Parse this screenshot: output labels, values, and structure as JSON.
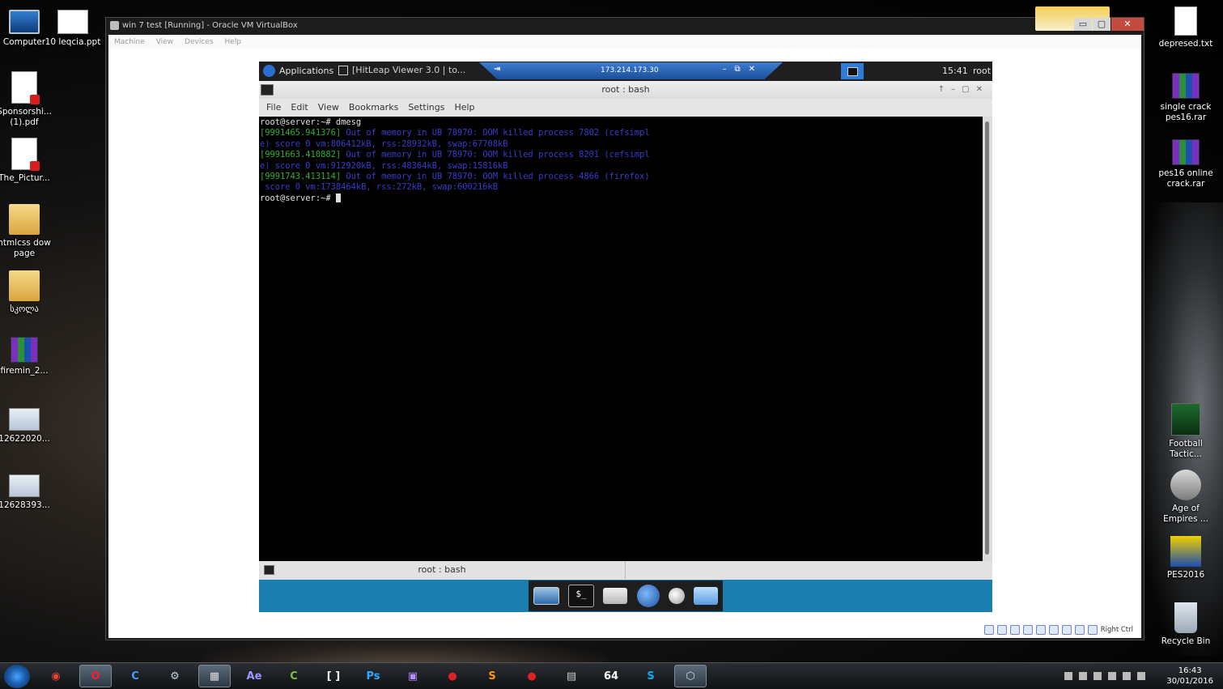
{
  "desktop": {
    "left_icons": [
      {
        "label": "Computer",
        "icon": "computer-icon"
      },
      {
        "label": "10 leqcia.ppt",
        "icon": "powerpoint-file-icon"
      },
      {
        "label": "Sponsorshi... (1).pdf",
        "icon": "pdf-file-icon"
      },
      {
        "label": "The_Pictur...",
        "icon": "pdf-file-icon"
      },
      {
        "label": "htmlcss dow page",
        "icon": "folder-icon"
      },
      {
        "label": "სკოლა",
        "icon": "folder-icon"
      },
      {
        "label": "firemin_2...",
        "icon": "rar-archive-icon"
      },
      {
        "label": "12622020...",
        "icon": "image-file-icon"
      },
      {
        "label": "12628393...",
        "icon": "image-file-icon"
      }
    ],
    "right_icons": [
      {
        "label": "depresed.txt",
        "icon": "text-file-icon"
      },
      {
        "label": "single crack pes16.rar",
        "icon": "rar-archive-icon"
      },
      {
        "label": "pes16 online crack.rar",
        "icon": "rar-archive-icon"
      },
      {
        "label": "Football Tactic...",
        "icon": "game-shortcut-icon"
      },
      {
        "label": "Age of Empires ...",
        "icon": "game-shortcut-icon"
      },
      {
        "label": "PES2016",
        "icon": "game-shortcut-icon"
      },
      {
        "label": "Recycle Bin",
        "icon": "recycle-bin-icon"
      }
    ]
  },
  "vbox": {
    "title": "win 7 test [Running] - Oracle VM VirtualBox",
    "controls": {
      "minimize": "▭",
      "restore": "▢",
      "close": "✕"
    },
    "menu": [
      "Machine",
      "View",
      "Devices",
      "Help"
    ],
    "status": {
      "host_key": "Right Ctrl"
    }
  },
  "guest": {
    "top_panel": {
      "applications": "Applications",
      "task": "[HitLeap Viewer 3.0 | to...",
      "remote_ip": "173.214.173.30",
      "remote_pin": "⇥",
      "remote_controls": "–⧉✕",
      "clock": "15:41",
      "user": "root"
    },
    "terminal": {
      "title": "root : bash",
      "window_controls": "↑–▢✕",
      "menu": [
        "File",
        "Edit",
        "View",
        "Bookmarks",
        "Settings",
        "Help"
      ],
      "lines": [
        {
          "ts": "",
          "msg": "root@server:~# dmesg",
          "kind": "prompt"
        },
        {
          "ts": "[9991465.941376]",
          "msg": " Out of memory in UB 78970: OOM killed process 7802 (cefsimpl",
          "kind": "log"
        },
        {
          "ts": "",
          "msg": "e) score 0 vm:806412kB, rss:28932kB, swap:67708kB",
          "kind": "cont"
        },
        {
          "ts": "[9991663.410882]",
          "msg": " Out of memory in UB 78970: OOM killed process 8201 (cefsimpl",
          "kind": "log"
        },
        {
          "ts": "",
          "msg": "e) score 0 vm:912920kB, rss:48364kB, swap:15816kB",
          "kind": "cont"
        },
        {
          "ts": "[9991743.413114]",
          "msg": " Out of memory in UB 78970: OOM killed process 4866 (firefox)",
          "kind": "log"
        },
        {
          "ts": "",
          "msg": " score 0 vm:1738464kB, rss:272kB, swap:600216kB",
          "kind": "cont"
        }
      ],
      "final_prompt": "root@server:~# ",
      "tab_label": "root : bash"
    },
    "dock": [
      "show-desktop-icon",
      "terminal-icon",
      "home-folder-icon",
      "web-browser-icon",
      "app-finder-icon",
      "file-manager-icon"
    ],
    "dock_term_glyph": "$_"
  },
  "taskbar": {
    "apps": [
      {
        "name": "chrome",
        "glyph": "◉",
        "color": "#e94235"
      },
      {
        "name": "opera",
        "glyph": "O",
        "color": "#ff1b2d"
      },
      {
        "name": "ccleaner",
        "glyph": "C",
        "color": "#3aa0ff"
      },
      {
        "name": "steam",
        "glyph": "⚙",
        "color": "#c7d5e0"
      },
      {
        "name": "video-editor",
        "glyph": "▦",
        "color": "#dddddd"
      },
      {
        "name": "after-effects",
        "glyph": "Ae",
        "color": "#9999ff"
      },
      {
        "name": "camtasia",
        "glyph": "C",
        "color": "#7ac143"
      },
      {
        "name": "brackets",
        "glyph": "[ ]",
        "color": "#ffffff"
      },
      {
        "name": "photoshop",
        "glyph": "Ps",
        "color": "#31a8ff"
      },
      {
        "name": "cpu-tool",
        "glyph": "▣",
        "color": "#b48cff"
      },
      {
        "name": "recorder",
        "glyph": "●",
        "color": "#e02020"
      },
      {
        "name": "sublime",
        "glyph": "S",
        "color": "#ff9800"
      },
      {
        "name": "record-button",
        "glyph": "●",
        "color": "#e02020"
      },
      {
        "name": "notepad",
        "glyph": "▤",
        "color": "#cccccc"
      },
      {
        "name": "64bit-tool",
        "glyph": "64",
        "color": "#ffffff"
      },
      {
        "name": "skype",
        "glyph": "S",
        "color": "#00aff0"
      },
      {
        "name": "virtualbox",
        "glyph": "⬡",
        "color": "#cfd8e6"
      }
    ],
    "time": "16:43",
    "date": "30/01/2016"
  }
}
